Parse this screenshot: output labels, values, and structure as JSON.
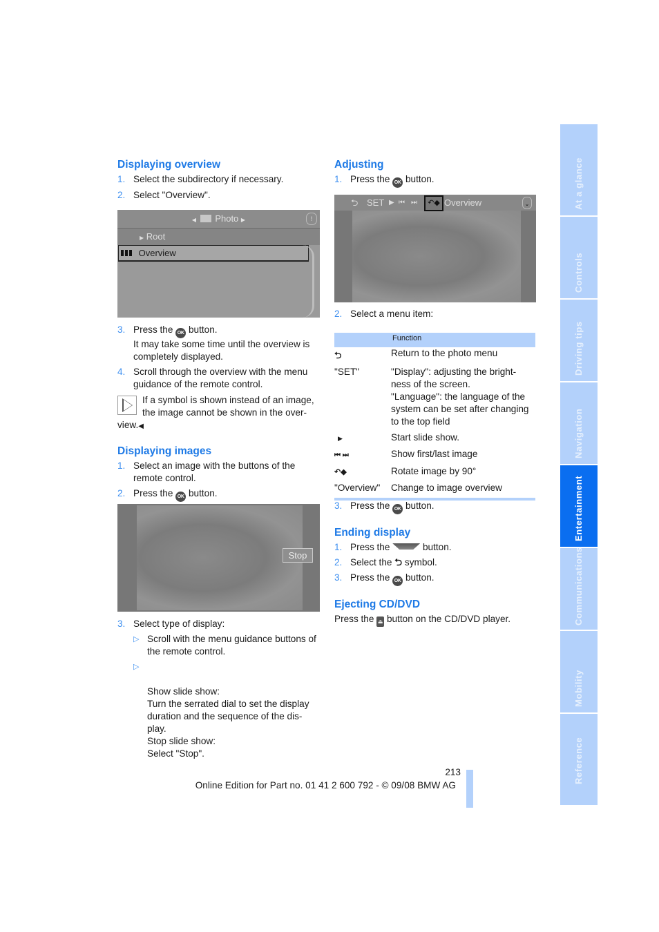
{
  "left_column": {
    "section1": {
      "title": "Displaying overview",
      "steps": [
        {
          "num": "1.",
          "text": "Select the subdirectory if necessary."
        },
        {
          "num": "2.",
          "text": "Select \"Overview\"."
        }
      ],
      "screen": {
        "header": "Photo",
        "items": [
          "Root",
          "Overview"
        ]
      },
      "steps_after": [
        {
          "num": "3.",
          "pre": "Press the",
          "icon": "OK",
          "post": "button.",
          "extra": "It may take some time until the overview is completely displayed."
        },
        {
          "num": "4.",
          "text": "Scroll through the overview with the menu guidance of the remote control."
        }
      ],
      "note": "If a symbol is shown instead of an image, the image cannot be shown in the over-view."
    },
    "section2": {
      "title": "Displaying images",
      "steps": [
        {
          "num": "1.",
          "text": "Select an image with the buttons of the remote control."
        },
        {
          "num": "2.",
          "pre": "Press the",
          "icon": "OK",
          "post": "button."
        }
      ],
      "screen": {
        "stop_label": "Stop"
      },
      "step3": {
        "num": "3.",
        "text": "Select type of display:",
        "bullets": [
          "Scroll with the menu guidance buttons of the remote control.",
          "Show slide show:\nTurn the serrated dial to set the display duration and the sequence of the dis-play.\nStop slide show:\nSelect \"Stop\"."
        ]
      }
    }
  },
  "right_column": {
    "section1": {
      "title": "Adjusting",
      "step1": {
        "num": "1.",
        "pre": "Press the",
        "icon": "OK",
        "post": "button."
      },
      "screen": {
        "set_label": "SET",
        "overview_label": "Overview"
      },
      "step2": {
        "num": "2.",
        "text": "Select a menu item:"
      },
      "table": {
        "header": "Function",
        "rows": [
          {
            "symbol": "return-icon",
            "label": "",
            "function": "Return to the photo menu"
          },
          {
            "symbol": "",
            "label": "\"SET\"",
            "function": "\"Display\": adjusting the bright-ness of the screen.\n\"Language\": the language of the system can be set after changing to the top field"
          },
          {
            "symbol": "play-icon",
            "label": "",
            "function": "Start slide show."
          },
          {
            "symbol": "first-last-icon",
            "label": "",
            "function": "Show first/last image"
          },
          {
            "symbol": "rotate-icon",
            "label": "",
            "function": "Rotate image by 90°"
          },
          {
            "symbol": "",
            "label": "\"Overview\"",
            "function": "Change to image overview"
          }
        ]
      },
      "step3": {
        "num": "3.",
        "pre": "Press the",
        "icon": "OK",
        "post": "button."
      }
    },
    "section2": {
      "title": "Ending display",
      "steps": [
        {
          "num": "1.",
          "pre": "Press the",
          "post": "button."
        },
        {
          "num": "2.",
          "pre": "Select the",
          "post": "symbol."
        },
        {
          "num": "3.",
          "pre": "Press the",
          "icon": "OK",
          "post": "button."
        }
      ]
    },
    "section3": {
      "title": "Ejecting CD/DVD",
      "pre": "Press the",
      "post": "button on the CD/DVD player."
    }
  },
  "side_tabs": [
    {
      "label": "At a glance",
      "active": false
    },
    {
      "label": "Controls",
      "active": false
    },
    {
      "label": "Driving tips",
      "active": false
    },
    {
      "label": "Navigation",
      "active": false
    },
    {
      "label": "Entertainment",
      "active": true
    },
    {
      "label": "Communications",
      "active": false
    },
    {
      "label": "Mobility",
      "active": false
    },
    {
      "label": "Reference",
      "active": false
    }
  ],
  "footer": {
    "page_number": "213",
    "edition": "Online Edition for Part no. 01 41 2 600 792 - © 09/08 BMW AG"
  },
  "colors": {
    "heading": "#1e7ae6",
    "tab": "#b3d1fb",
    "tab_active": "#0a6ef0",
    "table_header": "#b3d1fb"
  }
}
